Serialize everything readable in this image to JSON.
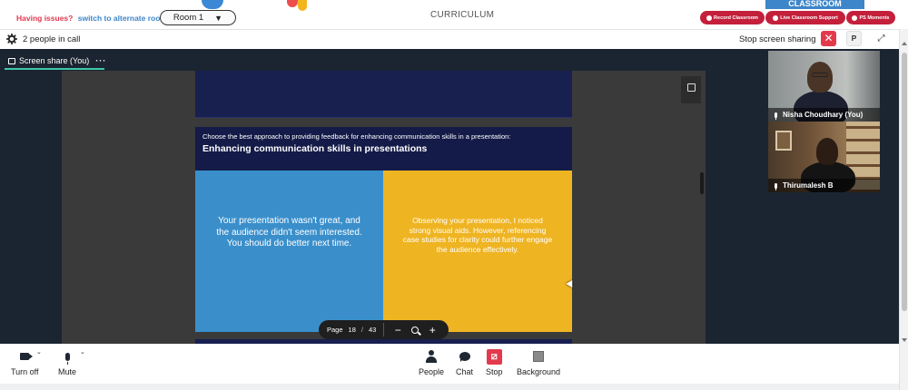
{
  "top": {
    "logo_text": "CLASSROOM",
    "issue_text": "Having issues?",
    "alternate_link": "switch to alternate room",
    "room_label": "Room 1",
    "room_caret": "▼",
    "curriculum": "CURRICULUM",
    "pills": {
      "record": "Record Classroom",
      "support": "Live Classroom Support",
      "moments": "PS Moments"
    }
  },
  "infobar": {
    "people_count": "2 people in call",
    "stop_sharing": "Stop screen sharing",
    "stop_x": "✕",
    "p_label": "P",
    "expand": "⤢"
  },
  "share": {
    "tab_label": "Screen share (You)",
    "more": "···"
  },
  "slide": {
    "question": "Choose the best approach to providing feedback for enhancing communication skills in a presentation:",
    "title": "Enhancing communication skills in presentations",
    "option_a": "Your presentation wasn't great, and the audience didn't seem interested. You should do better next time.",
    "option_b": "Observing your presentation, I noticed strong visual aids. However, referencing case studies for clarity could further engage the audience effectively."
  },
  "pager": {
    "page_label": "Page",
    "current": "18",
    "sep": "/",
    "total": "43",
    "minus": "−",
    "plus": "+"
  },
  "participants": [
    {
      "name": "Nisha Choudhary (You)"
    },
    {
      "name": "Thirumalesh B"
    }
  ],
  "toolbar": {
    "turn_off": "Turn off",
    "mute": "Mute",
    "people": "People",
    "chat": "Chat",
    "stop": "Stop",
    "background": "Background",
    "caret": "⌄"
  },
  "colors": {
    "accent_red": "#e23a4c",
    "accent_blue": "#3d86c9",
    "card_blue": "#3a8fcb",
    "card_yellow": "#efb422",
    "slide_navy": "#141b48"
  }
}
